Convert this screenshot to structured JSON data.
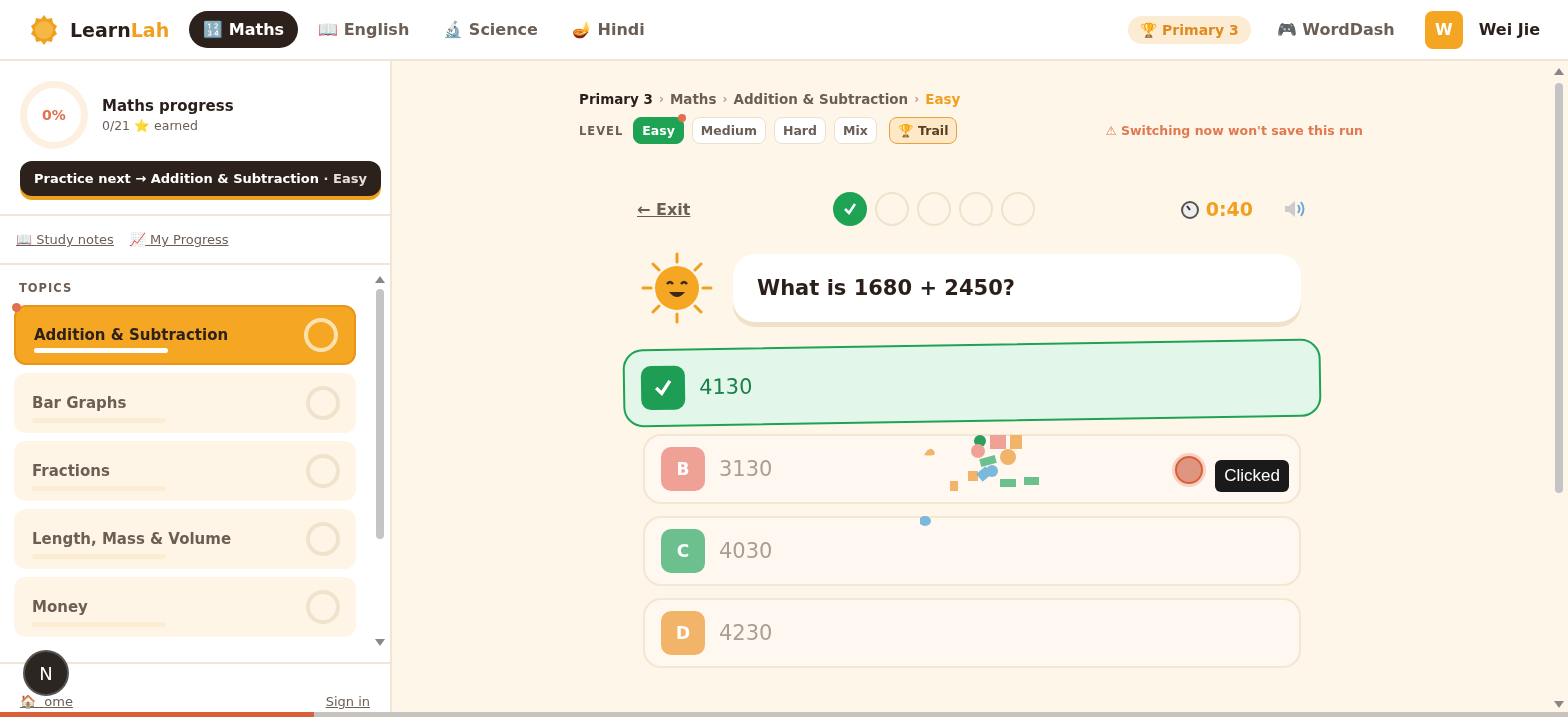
{
  "brand": {
    "name_a": "Learn",
    "name_b": "Lah"
  },
  "subjects": [
    {
      "label": "Maths",
      "icon": "🔢",
      "selected": true
    },
    {
      "label": "English",
      "icon": "📖",
      "selected": false
    },
    {
      "label": "Science",
      "icon": "🔬",
      "selected": false
    },
    {
      "label": "Hindi",
      "icon": "🪔",
      "selected": false
    }
  ],
  "grade_badge": {
    "icon": "🏆",
    "label": "Primary 3"
  },
  "game_link": {
    "icon": "🎮",
    "label": "WordDash"
  },
  "user": {
    "initial": "W",
    "name": "Wei Jie"
  },
  "progress": {
    "percent": "0%",
    "title": "Maths progress",
    "count": "0/21",
    "icon": "⭐",
    "suffix": "earned"
  },
  "practice_button": {
    "text": "Practice next → Addition & Subtraction",
    "level": "· Easy"
  },
  "links": [
    {
      "icon": "📖",
      "label": "Study notes"
    },
    {
      "icon": "📈",
      "label": "My Progress"
    }
  ],
  "topics_heading": "TOPICS",
  "topics": [
    {
      "label": "Addition & Subtraction",
      "selected": true
    },
    {
      "label": "Bar Graphs",
      "selected": false
    },
    {
      "label": "Fractions",
      "selected": false
    },
    {
      "label": "Length, Mass & Volume",
      "selected": false
    },
    {
      "label": "Money",
      "selected": false
    }
  ],
  "footer": {
    "home_icon": "🏠",
    "home": "ome",
    "sign_in": "Sign in",
    "badge": "N"
  },
  "load_bar": {
    "level": 0.2
  },
  "breadcrumb": [
    {
      "label": "Primary 3",
      "kind": "root"
    },
    {
      "separator": "›",
      "label": "Maths",
      "kind": "crumb"
    },
    {
      "separator": "›",
      "label": "Addition & Subtraction",
      "kind": "crumb"
    },
    {
      "separator": "›",
      "label": "Easy",
      "kind": "current"
    }
  ],
  "level_label": "LEVEL",
  "levels": [
    {
      "label": "Easy",
      "selected": true,
      "kind": "level"
    },
    {
      "label": "Medium",
      "selected": false,
      "kind": "level"
    },
    {
      "label": "Hard",
      "selected": false,
      "kind": "level"
    },
    {
      "label": "Mix",
      "selected": false,
      "kind": "level"
    },
    {
      "label": "Trail",
      "icon": "🏆",
      "selected": false,
      "kind": "trail"
    }
  ],
  "warning": "⚠ Switching now won't save this run",
  "exit": "← Exit",
  "steps": [
    {
      "done": true
    },
    {
      "done": false
    },
    {
      "done": false
    },
    {
      "done": false
    },
    {
      "done": false
    }
  ],
  "timer": "0:40",
  "question": "What is 1680 + 2450?",
  "options": [
    {
      "value": "4130",
      "correct": true,
      "color": "#1e9e55"
    },
    {
      "letter": "B",
      "value": "3130",
      "correct": false,
      "color": "#f0a196"
    },
    {
      "letter": "C",
      "value": "4030",
      "correct": false,
      "color": "#6cc08e"
    },
    {
      "letter": "D",
      "value": "4230",
      "correct": false,
      "color": "#f2b468"
    }
  ],
  "tooltip": "Clicked"
}
